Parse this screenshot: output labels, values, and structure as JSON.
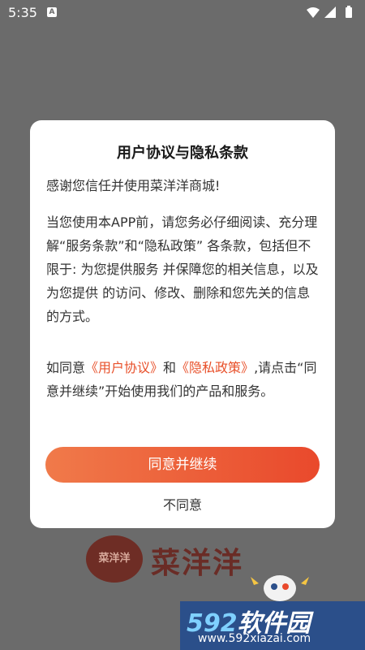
{
  "status_bar": {
    "time": "5:35",
    "notification_badge": "A",
    "icons": [
      "wifi-icon",
      "signal-icon",
      "battery-icon"
    ]
  },
  "dialog": {
    "title": "用户协议与隐私条款",
    "paragraph1": "感谢您信任并使用菜洋洋商城!",
    "paragraph2": "当您使用本APP前，请您务必仔细阅读、充分理解“服务条款”和“隐私政策” 各条款，包括但不限于: 为您提供服务 并保障您的相关信息，以及为您提供 的访问、修改、删除和您先关的信息 的方式。",
    "paragraph3": {
      "prefix": "如同意",
      "link_user": "《用户协议》",
      "and": "和",
      "link_privacy": "《隐私政策》",
      "suffix": ",请点击“同意并继续”开始使用我们的产品和服务。"
    },
    "agree_label": "同意并继续",
    "disagree_label": "不同意"
  },
  "background_logo": {
    "badge_text": "菜洋洋",
    "brand_text": "菜洋洋"
  },
  "watermark": {
    "number": "592",
    "name": "软件园",
    "url": "www.592xiazai.com"
  },
  "colors": {
    "overlay": "#6b6b6b",
    "accent": "#e8502a",
    "button_gradient_start": "#f07a4a",
    "button_gradient_end": "#e9492c"
  }
}
